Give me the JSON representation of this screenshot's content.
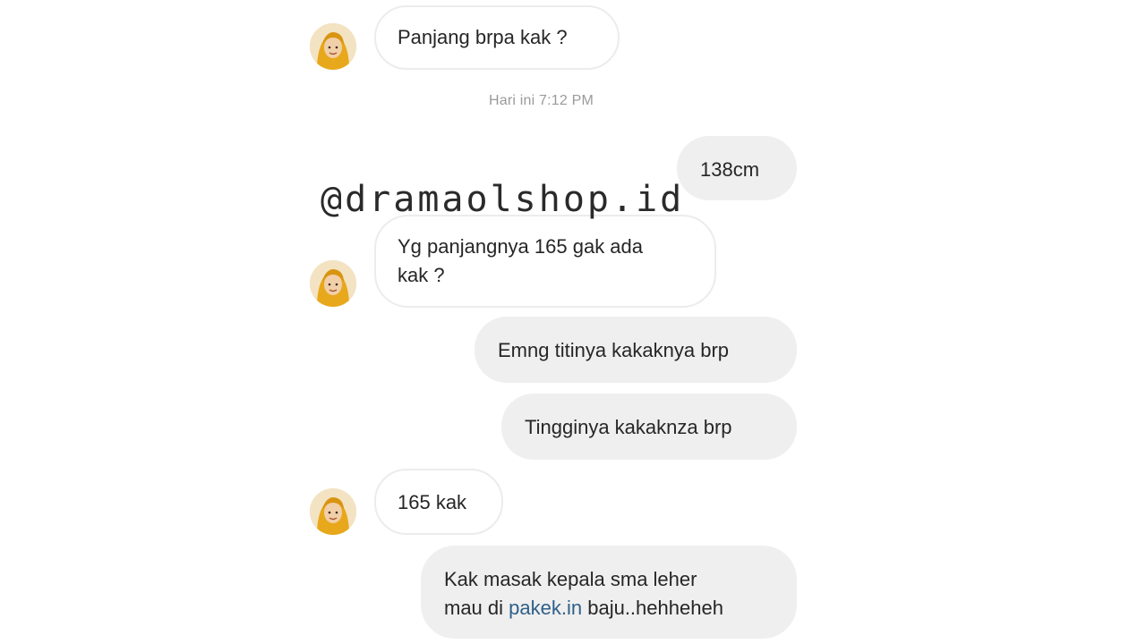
{
  "conversation": {
    "messages": [
      {
        "side": "in",
        "text": "Panjang brpa kak ?"
      },
      {
        "side": "out",
        "text": "138cm"
      },
      {
        "side": "in",
        "lines": [
          "Yg panjangnya 165 gak ada",
          "kak ?"
        ]
      },
      {
        "side": "out",
        "text": "Emng titinya kakaknya brp"
      },
      {
        "side": "out",
        "text": "Tingginya kakaknza brp"
      },
      {
        "side": "in",
        "text": "165 kak"
      },
      {
        "side": "out",
        "lines": [
          "Kak masak kepala sma leher",
          "mau di ",
          "pakek.in",
          " baju..hehheheh"
        ]
      }
    ],
    "timestamp": "Hari ini 7:12 PM"
  },
  "watermark": "@dramaolshop.id",
  "colors": {
    "incoming_bubble": "#ffffff",
    "incoming_border": "#ececec",
    "outgoing_bubble": "#efefef",
    "text": "#262626",
    "timestamp": "#9a9a9a",
    "link": "#2f5f8a"
  }
}
